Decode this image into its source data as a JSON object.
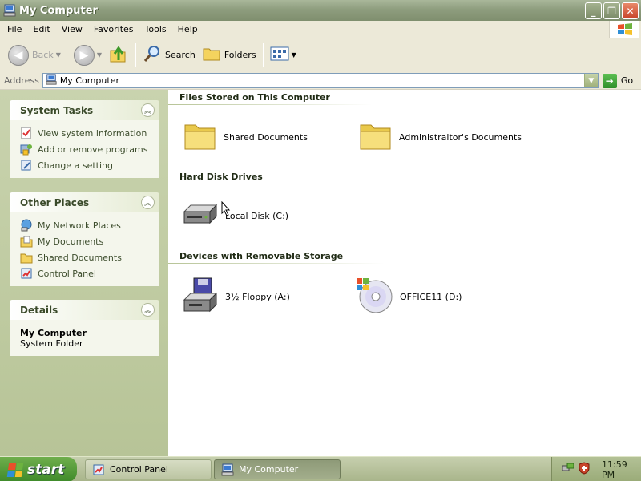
{
  "window": {
    "title": "My Computer"
  },
  "menu": [
    "File",
    "Edit",
    "View",
    "Favorites",
    "Tools",
    "Help"
  ],
  "toolbar": {
    "back": "Back",
    "search": "Search",
    "folders": "Folders"
  },
  "address": {
    "label": "Address",
    "value": "My Computer",
    "go": "Go"
  },
  "left": {
    "system_tasks": {
      "title": "System Tasks",
      "items": [
        "View system information",
        "Add or remove programs",
        "Change a setting"
      ]
    },
    "other_places": {
      "title": "Other Places",
      "items": [
        "My Network Places",
        "My Documents",
        "Shared Documents",
        "Control Panel"
      ]
    },
    "details": {
      "title": "Details",
      "name": "My Computer",
      "type": "System Folder"
    }
  },
  "content": {
    "files": {
      "title": "Files Stored on This Computer",
      "items": [
        "Shared Documents",
        "Administraitor's Documents"
      ]
    },
    "hdd": {
      "title": "Hard Disk Drives",
      "items": [
        "Local Disk (C:)"
      ]
    },
    "removable": {
      "title": "Devices with Removable Storage",
      "items": [
        "3½ Floppy (A:)",
        "OFFICE11 (D:)"
      ]
    }
  },
  "taskbar": {
    "start": "start",
    "buttons": [
      "Control Panel",
      "My Computer"
    ],
    "clock": "11:59 PM"
  },
  "colors": {
    "folder": "#f4d35e",
    "accent": "#3f8a2a",
    "close": "#c8452a"
  }
}
